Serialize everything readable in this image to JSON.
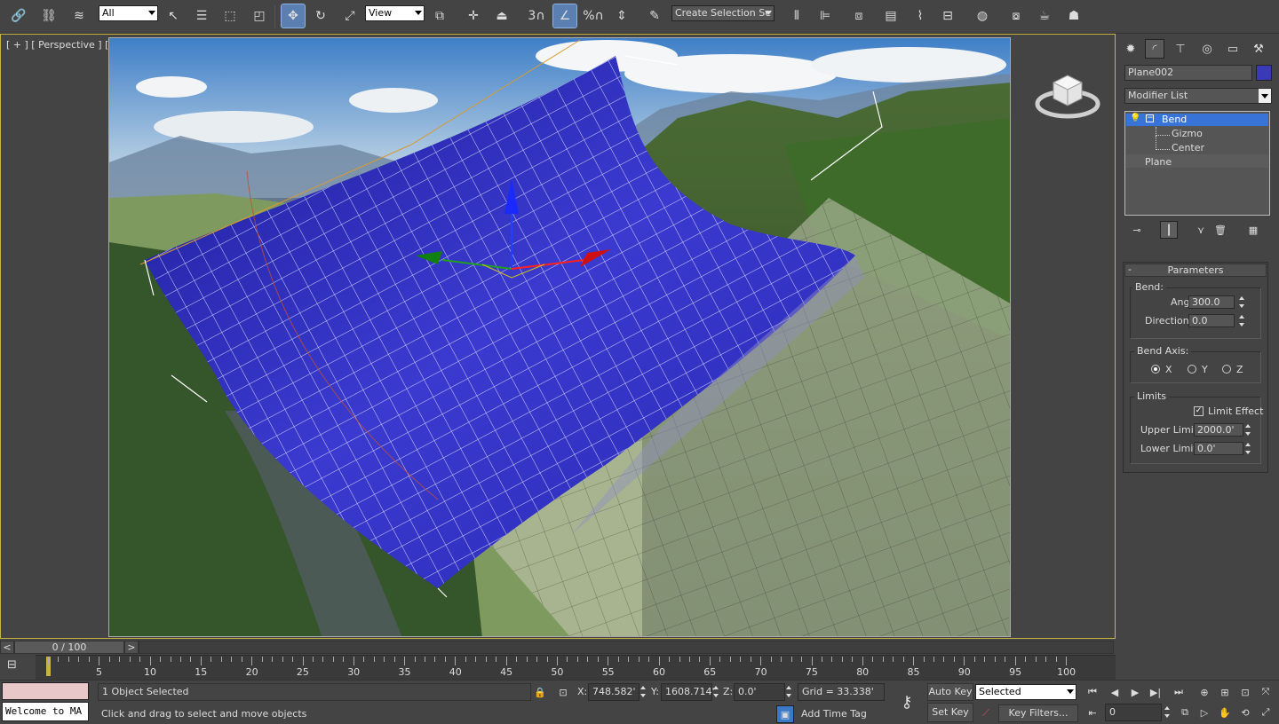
{
  "toolbar": {
    "selection_filter": "All",
    "ref_coord": "View",
    "named_selection_placeholder": "Create Selection Se",
    "snap_label": "3",
    "percent_snap_label": "%"
  },
  "viewport": {
    "label": "[ + ] [ Perspective ] [ Realistic + Edged Faces ]"
  },
  "command_panel": {
    "object_name": "Plane002",
    "object_color": "#3a3ab8",
    "modifier_list_label": "Modifier List",
    "stack": [
      {
        "label": "Bend",
        "selected": true
      },
      {
        "label": "Gizmo"
      },
      {
        "label": "Center"
      },
      {
        "label": "Plane"
      }
    ],
    "rollout_title": "Parameters",
    "bend_group": "Bend:",
    "angle_label": "Angle:",
    "angle_value": "300.0",
    "direction_label": "Direction:",
    "direction_value": "0.0",
    "axis_group": "Bend Axis:",
    "axis_x": "X",
    "axis_y": "Y",
    "axis_z": "Z",
    "limits_group": "Limits",
    "limit_effect_label": "Limit Effect",
    "upper_limit_label": "Upper Limit:",
    "upper_limit_value": "2000.0'",
    "lower_limit_label": "Lower Limit:",
    "lower_limit_value": "0.0'"
  },
  "timeline": {
    "frame_display": "0 / 100",
    "prev": "<",
    "next": ">",
    "ticks": [
      "5",
      "10",
      "15",
      "20",
      "25",
      "30",
      "35",
      "40",
      "45",
      "50",
      "55",
      "60",
      "65",
      "70",
      "75",
      "80",
      "85",
      "90",
      "95",
      "100"
    ]
  },
  "status": {
    "script_text": "Welcome to MA",
    "selection_count": "1 Object Selected",
    "prompt": "Click and drag to select and move objects",
    "x_label": "X:",
    "x_value": "748.582'",
    "y_label": "Y:",
    "y_value": "1608.714'",
    "z_label": "Z:",
    "z_value": "0.0'",
    "grid": "Grid = 33.338'",
    "add_time_tag": "Add Time Tag",
    "auto_key": "Auto Key",
    "set_key": "Set Key",
    "key_mode": "Selected",
    "key_filters": "Key Filters...",
    "current_frame": "0"
  }
}
